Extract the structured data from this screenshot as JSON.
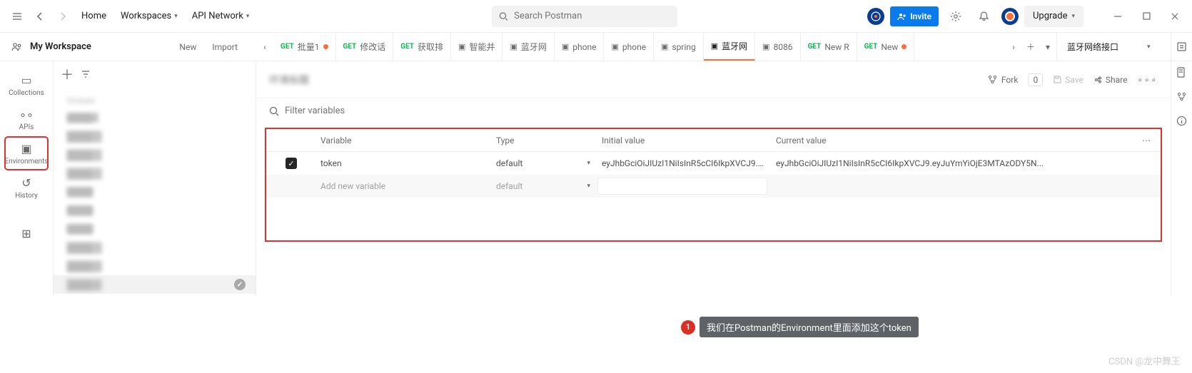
{
  "topnav": {
    "home": "Home",
    "workspaces": "Workspaces",
    "api_network": "API Network",
    "search_placeholder": "Search Postman",
    "invite": "Invite",
    "upgrade": "Upgrade"
  },
  "workspace": {
    "name": "My Workspace",
    "new_btn": "New",
    "import_btn": "Import"
  },
  "rail": {
    "collections": "Collections",
    "apis": "APIs",
    "environments": "Environments",
    "history": "History"
  },
  "sidebar": {
    "group_title": "G",
    "items": [
      {
        "label": "8"
      },
      {
        "label": "地"
      },
      {
        "label": "口"
      },
      {
        "label": "口"
      },
      {
        "label": " "
      },
      {
        "label": " "
      },
      {
        "label": " "
      },
      {
        "label": "大"
      },
      {
        "label": "里"
      },
      {
        "label": "里",
        "active": true
      }
    ]
  },
  "tabs": [
    {
      "kind": "get",
      "label": "批量1",
      "dot": true
    },
    {
      "kind": "get",
      "label": "修改话"
    },
    {
      "kind": "get",
      "label": "获取排"
    },
    {
      "kind": "sq",
      "label": "智能并"
    },
    {
      "kind": "sq",
      "label": "蓝牙网"
    },
    {
      "kind": "sq",
      "label": "phone"
    },
    {
      "kind": "sq",
      "label": "phone"
    },
    {
      "kind": "sq",
      "label": "spring"
    },
    {
      "kind": "sq",
      "label": "蓝牙网",
      "active": true
    },
    {
      "kind": "sq",
      "label": "8086"
    },
    {
      "kind": "get",
      "label": "New R"
    },
    {
      "kind": "get",
      "label": "New",
      "dot": true
    }
  ],
  "env_selector": "蓝牙网络接口",
  "content_header": {
    "title": "环境标题",
    "fork": "Fork",
    "fork_count": "0",
    "save": "Save",
    "share": "Share"
  },
  "filter_placeholder": "Filter variables",
  "table": {
    "headers": {
      "variable": "Variable",
      "type": "Type",
      "initial": "Initial value",
      "current": "Current value"
    },
    "rows": [
      {
        "checked": true,
        "variable": "token",
        "type": "default",
        "initial": "eyJhbGciOiJIUzI1NiIsInR5cCI6IkpXVCJ9.e...",
        "current": "eyJhbGciOiJIUzI1NiIsInR5cCI6IkpXVCJ9.eyJuYmYiOjE3MTAzODY5N..."
      }
    ],
    "add_placeholder": "Add new variable",
    "add_type": "default"
  },
  "callout": {
    "num": "1",
    "text": "我们在Postman的Environment里面添加这个token"
  },
  "watermark": "CSDN @龙中舞王"
}
